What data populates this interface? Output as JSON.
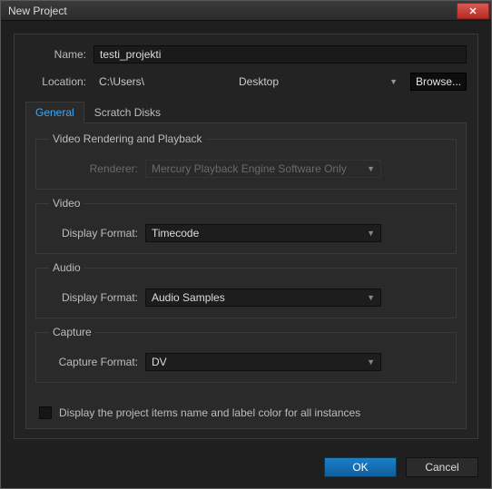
{
  "window": {
    "title": "New Project"
  },
  "fields": {
    "name_label": "Name:",
    "name_value": "testi_projekti",
    "location_label": "Location:",
    "location_path_left": "C:\\Users\\",
    "location_path_mid": "Desktop",
    "browse_label": "Browse..."
  },
  "tabs": {
    "general": "General",
    "scratch": "Scratch Disks"
  },
  "groups": {
    "video_render": {
      "legend": "Video Rendering and Playback",
      "renderer_label": "Renderer:",
      "renderer_value": "Mercury Playback Engine Software Only"
    },
    "video": {
      "legend": "Video",
      "display_format_label": "Display Format:",
      "display_format_value": "Timecode"
    },
    "audio": {
      "legend": "Audio",
      "display_format_label": "Display Format:",
      "display_format_value": "Audio Samples"
    },
    "capture": {
      "legend": "Capture",
      "capture_format_label": "Capture Format:",
      "capture_format_value": "DV"
    }
  },
  "checkbox": {
    "label": "Display the project items name and label color for all instances"
  },
  "footer": {
    "ok": "OK",
    "cancel": "Cancel"
  }
}
